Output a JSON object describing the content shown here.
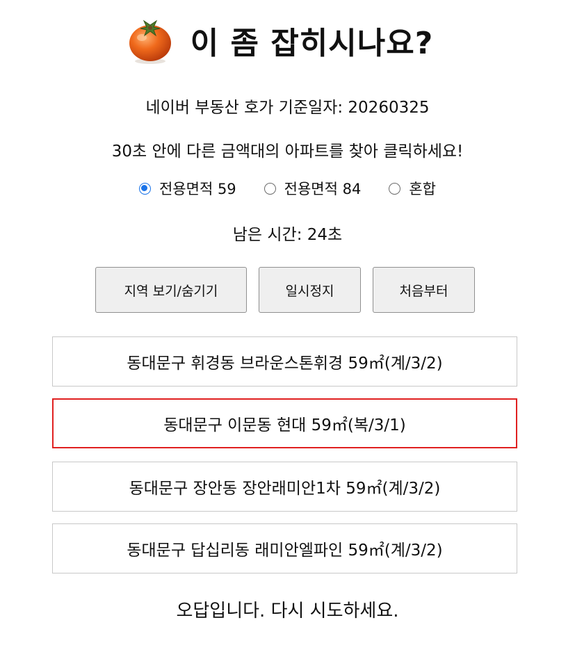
{
  "header": {
    "title": "이 좀 잡히시나요?",
    "icon": "persimmon-icon"
  },
  "info": {
    "base_date": "네이버 부동산 호가 기준일자: 20260325",
    "instruction": "30초 안에 다른 금액대의 아파트를 찾아 클릭하세요!"
  },
  "area_options": [
    {
      "label": "전용면적 59",
      "checked": true
    },
    {
      "label": "전용면적 84",
      "checked": false
    },
    {
      "label": "혼합",
      "checked": false
    }
  ],
  "timer": {
    "text": "남은 시간: 24초"
  },
  "controls": {
    "toggle_region_label": "지역 보기/숨기기",
    "pause_label": "일시정지",
    "restart_label": "처음부터"
  },
  "apartments": [
    {
      "label": "동대문구 휘경동 브라운스톤휘경 59㎡(계/3/2)",
      "selected": false
    },
    {
      "label": "동대문구 이문동 현대 59㎡(복/3/1)",
      "selected": true
    },
    {
      "label": "동대문구 장안동 장안래미안1차 59㎡(계/3/2)",
      "selected": false
    },
    {
      "label": "동대문구 답십리동 래미안엘파인 59㎡(계/3/2)",
      "selected": false
    }
  ],
  "result": {
    "message": "오답입니다. 다시 시도하세요."
  },
  "colors": {
    "accent": "#1a73e8",
    "selected_border": "#e02020"
  }
}
